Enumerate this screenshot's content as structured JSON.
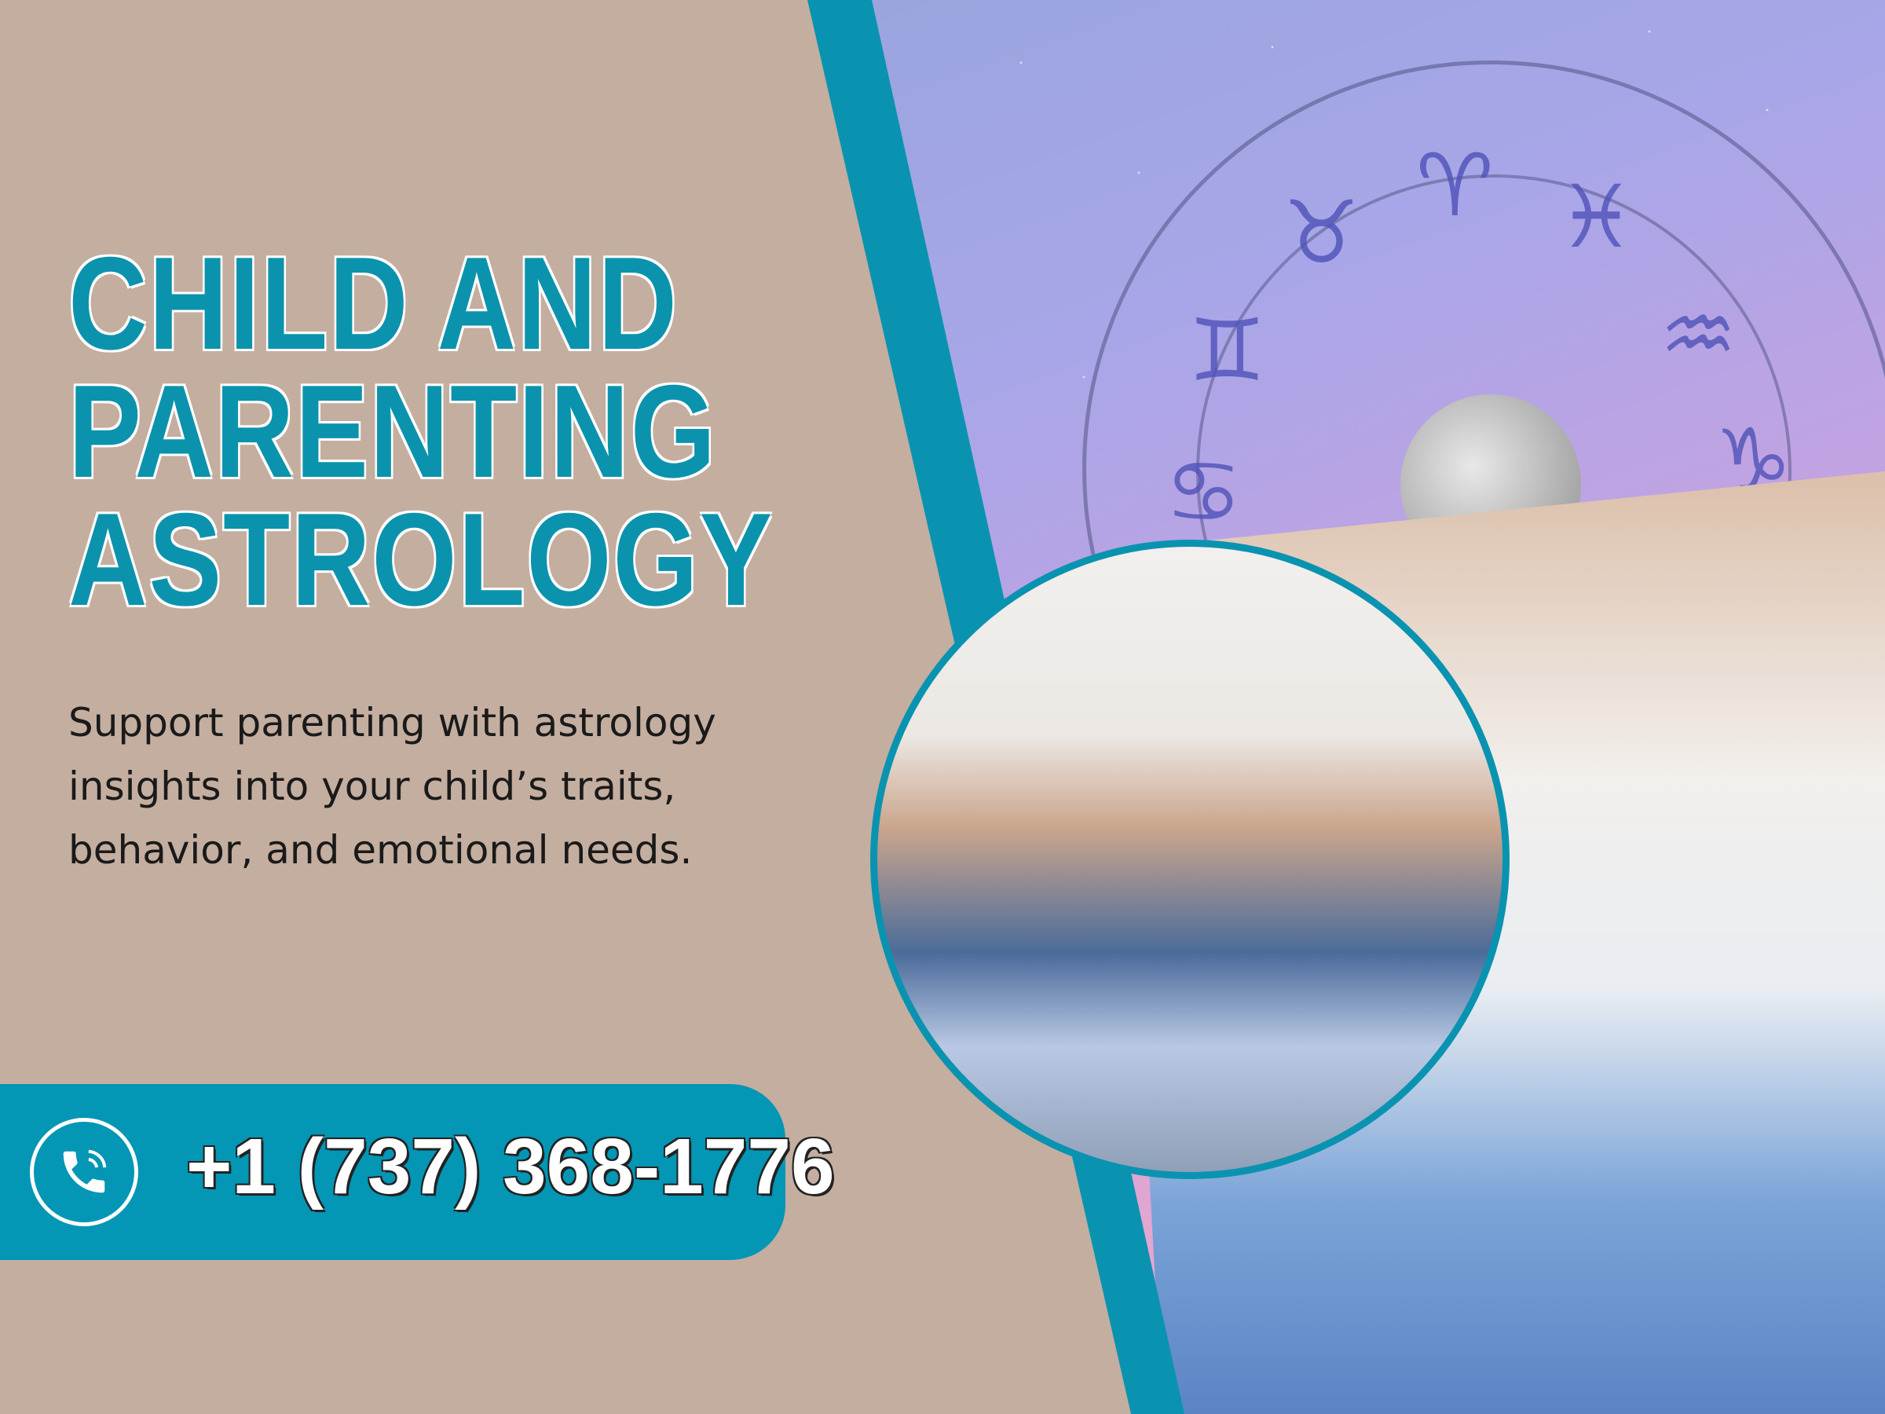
{
  "headline": {
    "line1": "CHILD AND",
    "line2": "PARENTING",
    "line3": "ASTROLOGY"
  },
  "description": {
    "line1": "Support parenting with astrology",
    "line2": "insights into your child’s traits,",
    "line3": "behavior, and emotional needs."
  },
  "contact": {
    "icon": "phone-icon",
    "phone": "+1 (737) 368-1776"
  },
  "zodiac": {
    "glyphs": [
      "♉",
      "♈",
      "♓",
      "♊",
      "♒",
      "♋",
      "♑"
    ]
  },
  "colors": {
    "accent": "#0a93b0",
    "background": "#c4aea0",
    "text": "#1a1a1a"
  }
}
